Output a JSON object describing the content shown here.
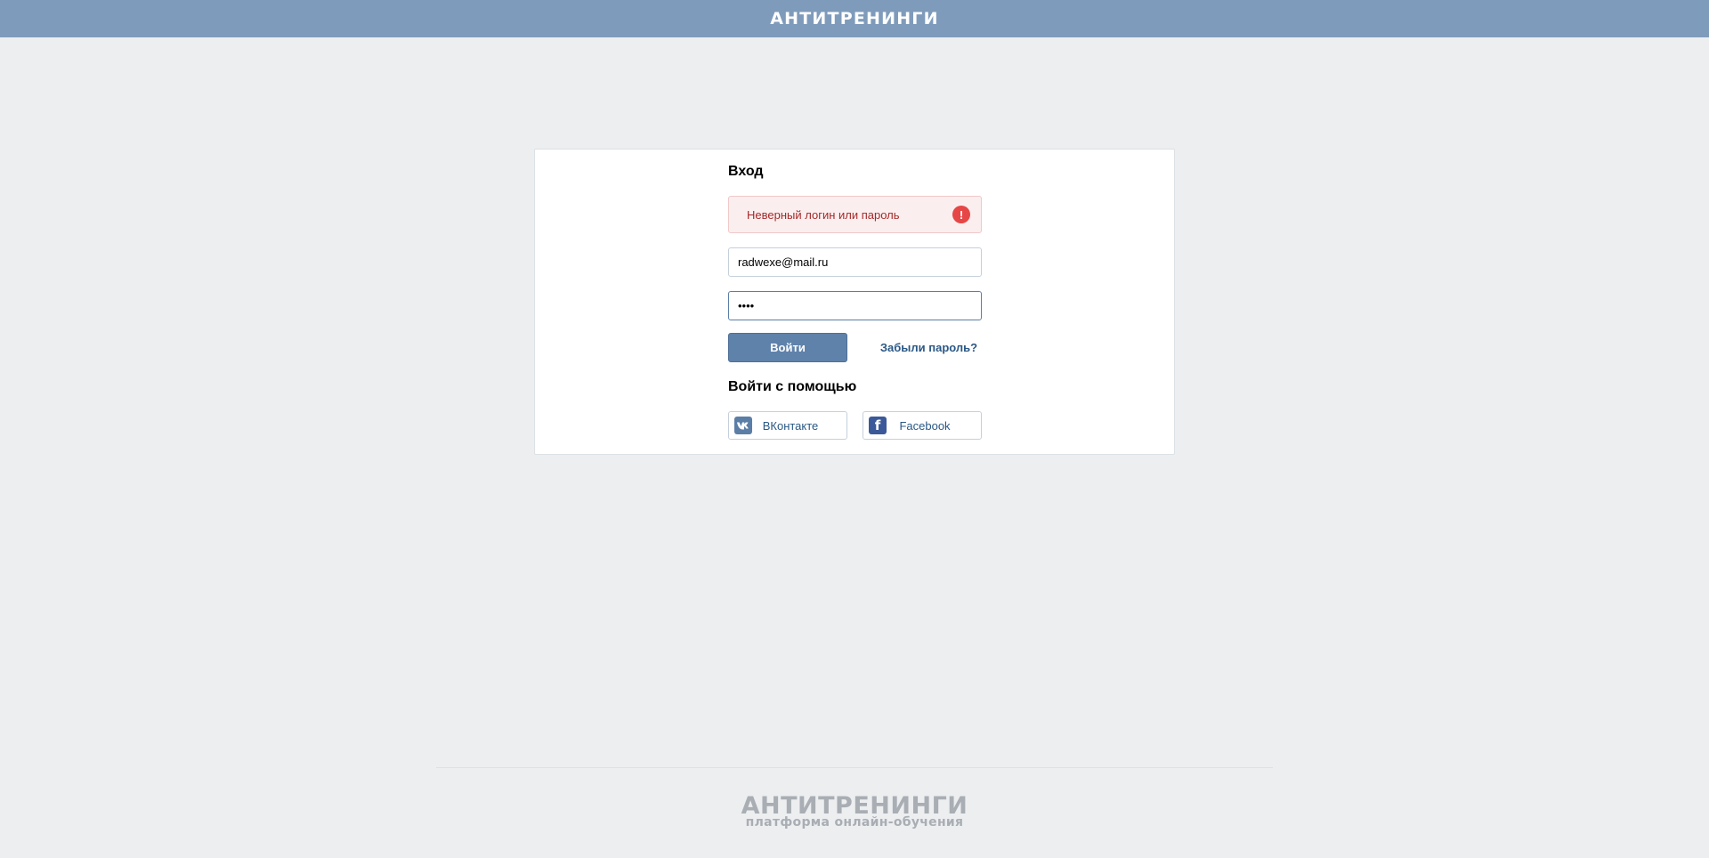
{
  "header": {
    "logo_text": "АНТИТРЕНИНГИ"
  },
  "login": {
    "title": "Вход",
    "error_message": "Неверный логин или пароль",
    "error_icon": "!",
    "email_value": "radwexe@mail.ru",
    "password_value": "••••",
    "login_button": "Войти",
    "forgot_link": "Забыли пароль?",
    "social_title": "Войти с помощью",
    "social": [
      {
        "label": "ВКонтакте",
        "icon": "vk-icon"
      },
      {
        "label": "Facebook",
        "icon": "facebook-icon"
      }
    ]
  },
  "footer": {
    "logo_text": "АНТИТРЕНИНГИ",
    "tagline": "платформа онлайн-обучения"
  },
  "colors": {
    "header_bg": "#7f9bbb",
    "button_bg": "#5f82ab",
    "error_bg": "#fbeeee",
    "error_icon": "#e64646",
    "link": "#2a5885"
  }
}
